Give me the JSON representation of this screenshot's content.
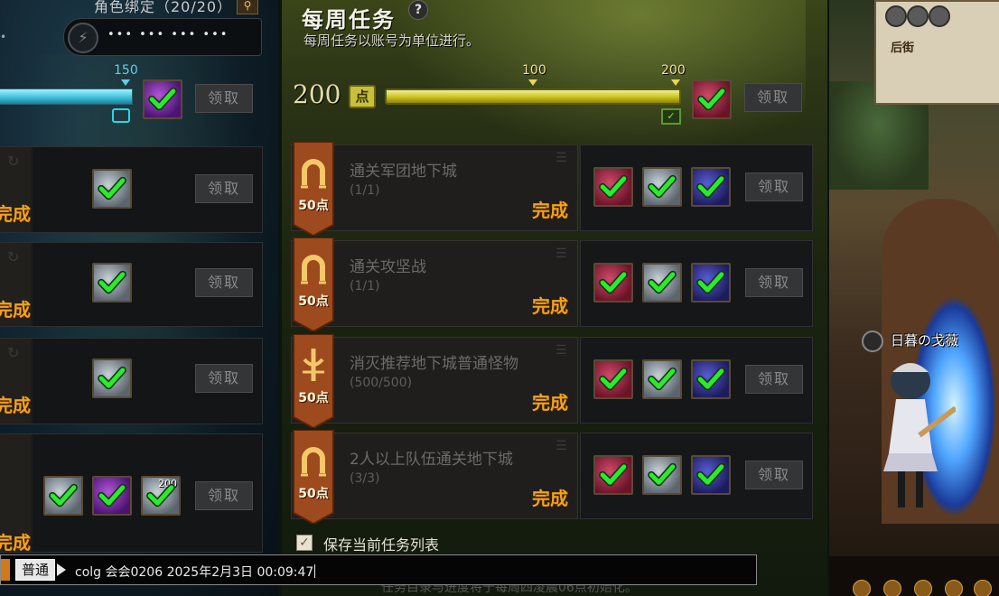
{
  "left_panel": {
    "bind_title": "角色绑定（20/20）",
    "password_mask": "••• ••• ••• •••",
    "progress_max_label": "150",
    "progress": 1.0,
    "claim_label": "领取",
    "done_label": "完成",
    "tasks": [
      {
        "done": "完成",
        "claim": "领取"
      },
      {
        "done": "完成",
        "claim": "领取"
      },
      {
        "done": "完成",
        "claim": "领取"
      },
      {
        "done": "完成",
        "claim": "领取",
        "reward_count": "200"
      }
    ]
  },
  "weekly": {
    "title": "每周任务",
    "subtitle": "每周任务以账号为单位进行。",
    "points_value": "200",
    "points_badge": "点",
    "milestones": [
      "100",
      "200"
    ],
    "progress": 1.0,
    "claim_label": "领取",
    "tasks": [
      {
        "name": "通关军团地下城",
        "progress": "(1/1)",
        "points": "50点",
        "status": "完成",
        "icon": "horseshoe-icon"
      },
      {
        "name": "通关攻坚战",
        "progress": "(1/1)",
        "points": "50点",
        "status": "完成",
        "icon": "horseshoe-icon"
      },
      {
        "name": "消灭推荐地下城普通怪物",
        "progress": "(500/500)",
        "points": "50点",
        "status": "完成",
        "icon": "sword-icon"
      },
      {
        "name": "2人以上队伍通关地下城",
        "progress": "(3/3)",
        "points": "50点",
        "status": "完成",
        "icon": "horseshoe-icon"
      }
    ],
    "save_label": "保存当前任务列表",
    "bottom_ghost_text": "任务目录与进度将于每周四凌晨06点初始化。"
  },
  "scene": {
    "minimap_label": "后街",
    "character_name": "日暮の戈薇"
  },
  "chat": {
    "channel": "普通",
    "message": "colg 会会0206 2025年2月3日 00:09:47"
  },
  "colors": {
    "accent_gold": "#f3a21b",
    "check_green": "#2ee832",
    "bar_yellow": "#c9c21c",
    "bar_cyan": "#39bcd8"
  }
}
